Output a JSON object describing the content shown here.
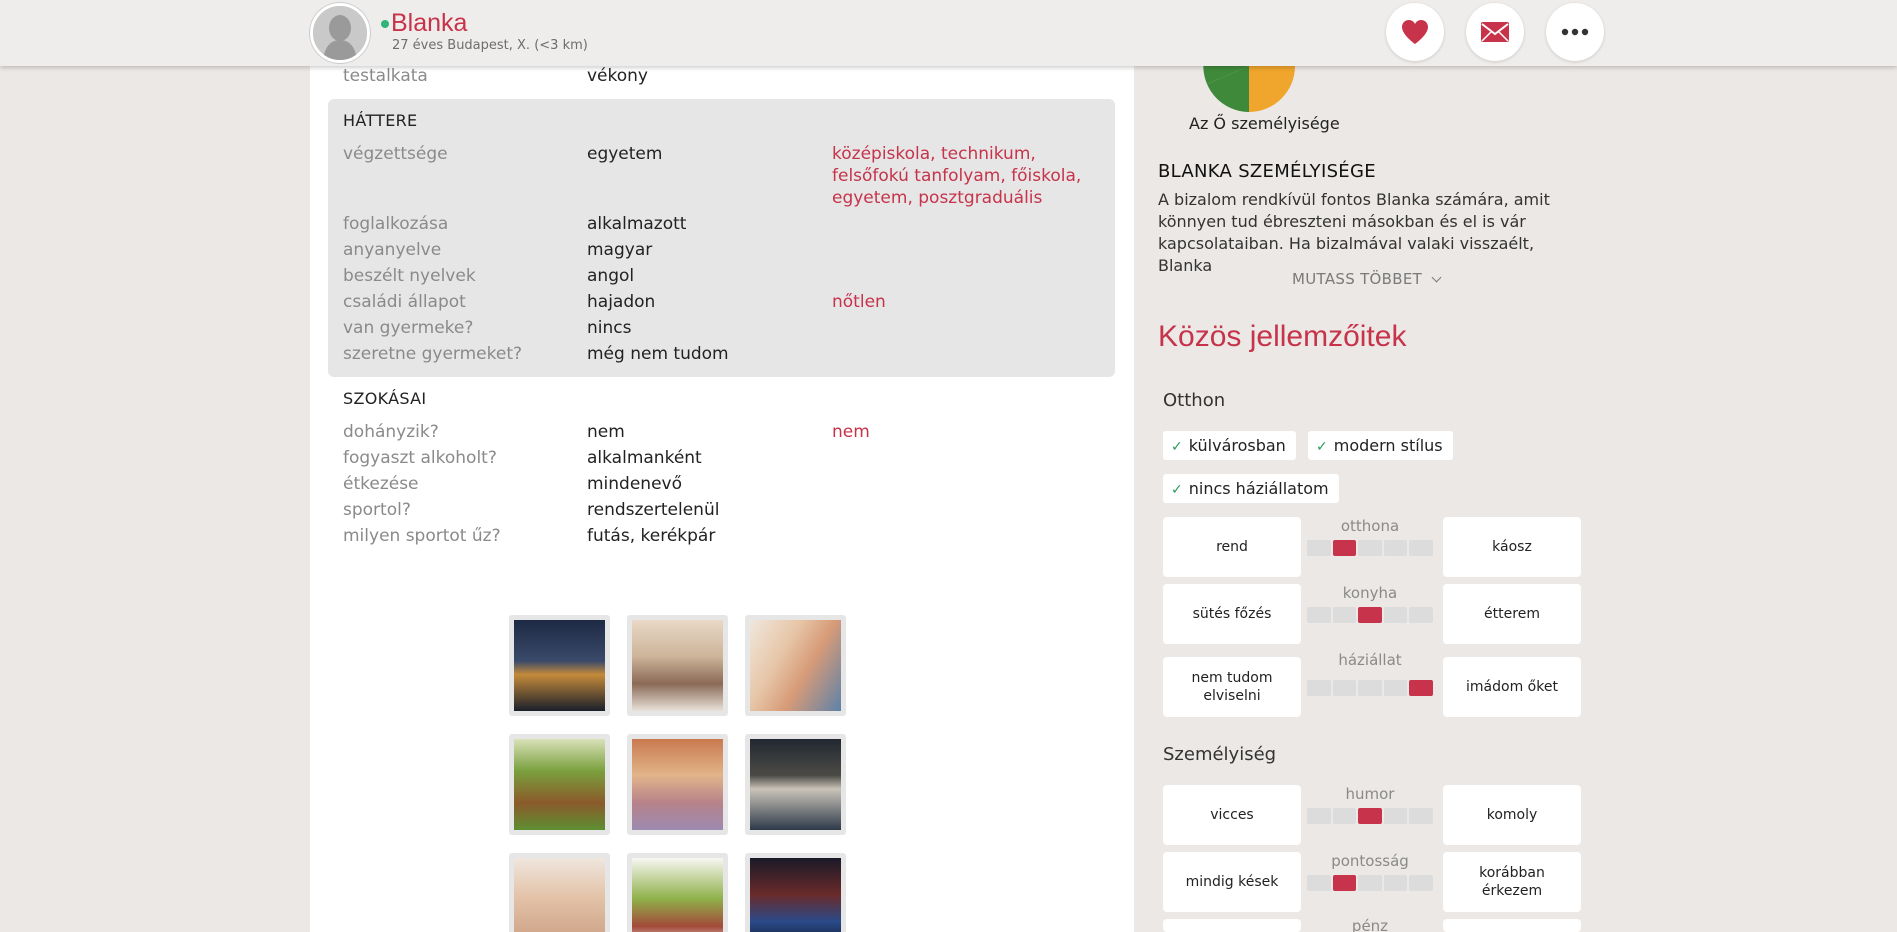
{
  "header": {
    "name": "Blanka",
    "subtitle": "27 éves Budapest, X. (<3 km)",
    "buttons": [
      "heart-icon",
      "envelope-icon",
      "more-icon"
    ],
    "accent": "#c6334a"
  },
  "profile": {
    "top_row": {
      "label": "testalkata",
      "value": "vékony"
    },
    "background": {
      "title": "HÁTTERE",
      "rows": [
        {
          "label": "végzettsége",
          "value": "egyetem",
          "match": "középiskola, technikum,"
        },
        {
          "label": "foglalkozása",
          "value": "alkalmazott",
          "match": ""
        },
        {
          "label": "anyanyelve",
          "value": "magyar",
          "match": ""
        },
        {
          "label": "beszélt nyelvek",
          "value": "angol",
          "match": ""
        },
        {
          "label": "családi állapot",
          "value": "hajadon",
          "match": "nőtlen"
        },
        {
          "label": "van gyermeke?",
          "value": "nincs",
          "match": ""
        },
        {
          "label": "szeretne gyermeket?",
          "value": "még nem tudom",
          "match": ""
        }
      ],
      "education_match_line2": "felsőfokú tanfolyam, főiskola,",
      "education_match_line3": "egyetem, posztgraduális"
    },
    "habits": {
      "title": "SZOKÁSAI",
      "rows": [
        {
          "label": "dohányzik?",
          "value": "nem",
          "match": "nem"
        },
        {
          "label": "fogyaszt alkoholt?",
          "value": "alkalmanként",
          "match": ""
        },
        {
          "label": "étkezése",
          "value": "mindenevő",
          "match": ""
        },
        {
          "label": "sportol?",
          "value": "rendszertelenül",
          "match": ""
        },
        {
          "label": "milyen sportot űz?",
          "value": "futás, kerékpár",
          "match": ""
        }
      ]
    }
  },
  "personality": {
    "caption": "Az Ő személyisége",
    "title": "BLANKA SZEMÉLYISÉGE",
    "text": "A bizalom rendkívül fontos Blanka számára, amit könnyen tud ébreszteni másokban és el is vár kapcsolataiban. Ha bizalmával valaki visszaélt, Blanka",
    "show_more": "MUTASS TÖBBET"
  },
  "common": {
    "title": "Közös jellemzőitek",
    "home": {
      "title": "Otthon",
      "tags": [
        "külvárosban",
        "modern stílus",
        "nincs háziállatom"
      ],
      "scales": [
        {
          "left": "rend",
          "label": "otthona",
          "right": "káosz",
          "level": 2
        },
        {
          "left": "sütés főzés",
          "label": "konyha",
          "right": "étterem",
          "level": 3
        },
        {
          "left": "nem tudom elviselni",
          "label": "háziállat",
          "right": "imádom őket",
          "level": 5
        }
      ]
    },
    "personality": {
      "title": "Személyiség",
      "scales": [
        {
          "left": "vicces",
          "label": "humor",
          "right": "komoly",
          "level": 3
        },
        {
          "left": "mindig kések",
          "label": "pontosság",
          "right": "korábban érkezem",
          "level": 2
        }
      ],
      "partial_label": "pénz"
    }
  },
  "colors": {
    "accent": "#c6334a",
    "page_bg": "#ebe8e5",
    "online": "#2fb37a",
    "pie_green": "#3f8a3a",
    "pie_orange": "#f0a52c"
  }
}
